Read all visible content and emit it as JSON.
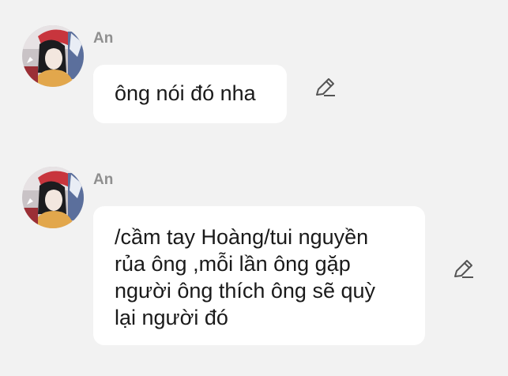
{
  "messages": [
    {
      "sender": "An",
      "text": "ông nói đó nha",
      "edit_icon": "pencil-icon"
    },
    {
      "sender": "An",
      "lines": [
        "/cầm tay Hoàng/tui nguyền",
        "rủa ông ,mỗi lần ông gặp",
        "người ông thích ông sẽ quỳ",
        "lại người đó"
      ],
      "edit_icon": "pencil-icon"
    }
  ],
  "colors": {
    "background": "#f2f2f2",
    "bubble": "#ffffff",
    "sender_name": "#8f8f8f",
    "text": "#1a1a1a",
    "icon": "#555555"
  }
}
